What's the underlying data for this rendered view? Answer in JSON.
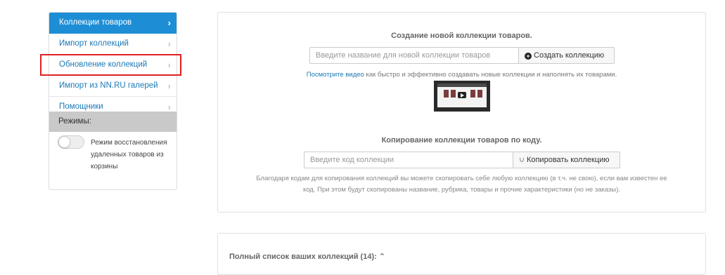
{
  "sidebar": {
    "items": [
      {
        "label": "Коллекции товаров"
      },
      {
        "label": "Импорт коллекций"
      },
      {
        "label": "Обновление коллекций"
      },
      {
        "label": "Импорт из NN.RU галерей"
      },
      {
        "label": "Помощники"
      }
    ],
    "modes_title": "Режимы:",
    "toggle_label": "Режим восстановления удаленных товаров из корзины",
    "toggle_on": false
  },
  "create": {
    "title": "Создание новой коллекции товаров.",
    "placeholder": "Введите название для новой коллекции товаров",
    "button": "Создать коллекцию",
    "video_link": "Посмотрите видео",
    "video_text": " как быстро и эффективно создавать новые коллекции и наполнять их товарами."
  },
  "copy": {
    "title": "Копирование коллекции товаров по коду.",
    "placeholder": "Введите код коллекции",
    "button": "Копировать коллекцию",
    "note_line1": "Благодаря кодам для копирования коллекций вы можете скопировать себе любую коллекцию (в т.ч. не свою), если вам известен ее",
    "note_line2": "код. При этом будут скопированы название, рубрика, товары и прочие характеристики (но не заказы)."
  },
  "list": {
    "title": "Полный список ваших коллекций (14):",
    "caret": "⌃"
  },
  "colors": {
    "accent": "#1d8ed6",
    "link": "#1a78b5",
    "highlight": "#e02020"
  }
}
